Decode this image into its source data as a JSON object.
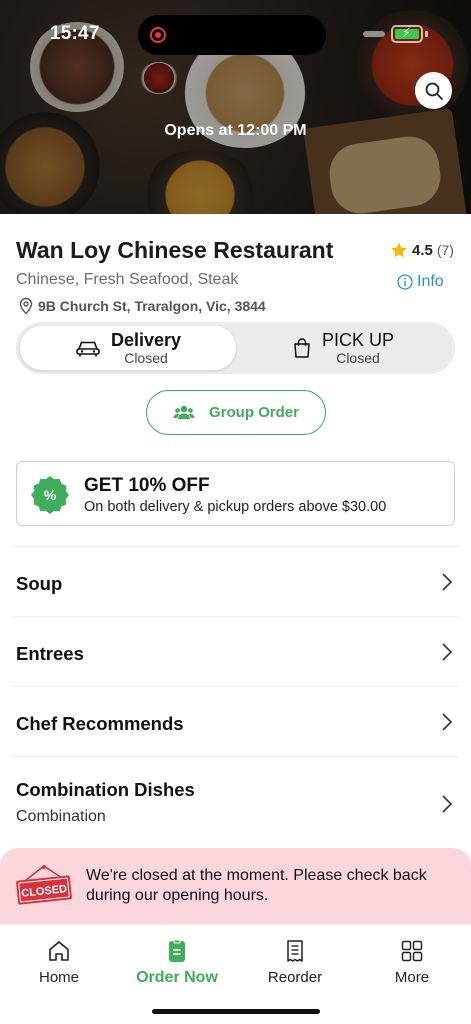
{
  "status_bar": {
    "time": "15:47"
  },
  "hero": {
    "opens_text": "Opens at 12:00 PM"
  },
  "restaurant": {
    "name": "Wan Loy Chinese Restaurant",
    "rating": "4.5",
    "rating_count": "(7)",
    "cuisines": "Chinese, Fresh Seafood, Steak",
    "info_label": "Info",
    "address": "9B Church St, Traralgon, Vic, 3844"
  },
  "order_mode": {
    "delivery": {
      "label": "Delivery",
      "status": "Closed",
      "selected": true
    },
    "pickup": {
      "label": "PICK UP",
      "status": "Closed",
      "selected": false
    }
  },
  "group_order_label": "Group Order",
  "promo": {
    "title": "GET 10% OFF",
    "subtitle": "On both delivery & pickup orders above $30.00"
  },
  "categories": [
    {
      "label": "Soup",
      "subtitle": ""
    },
    {
      "label": "Entrees",
      "subtitle": ""
    },
    {
      "label": "Chef Recommends",
      "subtitle": ""
    },
    {
      "label": "Combination Dishes",
      "subtitle": "Combination"
    }
  ],
  "closed_banner": {
    "sign_text": "CLOSED",
    "message": "We're closed at the moment. Please check back during our opening hours."
  },
  "bottom_nav": [
    {
      "label": "Home",
      "icon": "home-icon",
      "active": false
    },
    {
      "label": "Order Now",
      "icon": "order-icon",
      "active": true
    },
    {
      "label": "Reorder",
      "icon": "receipt-icon",
      "active": false
    },
    {
      "label": "More",
      "icon": "grid-icon",
      "active": false
    }
  ],
  "colors": {
    "accent_green": "#3fae5a",
    "info_blue": "#2a8fd6",
    "star": "#f5b800",
    "closed_banner_bg": "#fbd7dc",
    "closed_red": "#d8323c"
  }
}
